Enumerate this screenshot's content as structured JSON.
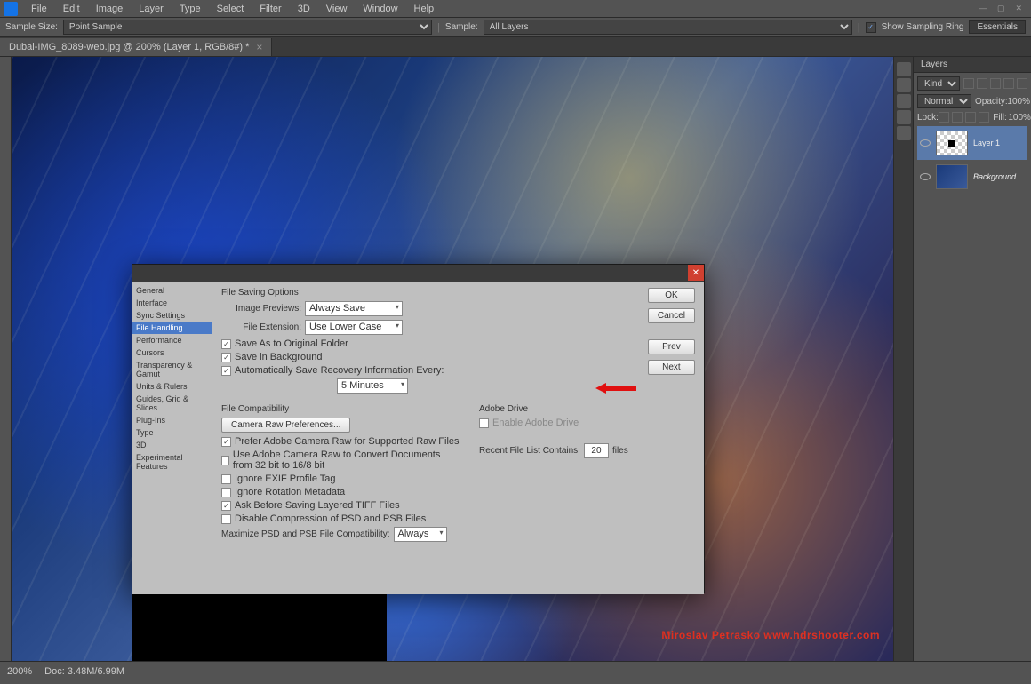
{
  "menubar": {
    "items": [
      "File",
      "Edit",
      "Image",
      "Layer",
      "Type",
      "Select",
      "Filter",
      "3D",
      "View",
      "Window",
      "Help"
    ]
  },
  "options": {
    "sample_size_label": "Sample Size:",
    "sample_size_value": "Point Sample",
    "sample_label": "Sample:",
    "sample_value": "All Layers",
    "sampling_ring": "Show Sampling Ring",
    "essentials": "Essentials"
  },
  "doc_tab": "Dubai-IMG_8089-web.jpg @ 200% (Layer 1, RGB/8#) *",
  "layers_panel": {
    "title": "Layers",
    "kind": "Kind",
    "blend": "Normal",
    "opacity_label": "Opacity:",
    "opacity_val": "100%",
    "lock_label": "Lock:",
    "fill_label": "Fill:",
    "fill_val": "100%",
    "layer1": "Layer 1",
    "background": "Background"
  },
  "dialog": {
    "nav": [
      "General",
      "Interface",
      "Sync Settings",
      "File Handling",
      "Performance",
      "Cursors",
      "Transparency & Gamut",
      "Units & Rulers",
      "Guides, Grid & Slices",
      "Plug-Ins",
      "Type",
      "3D",
      "Experimental Features"
    ],
    "selected_nav": "File Handling",
    "btn_ok": "OK",
    "btn_cancel": "Cancel",
    "btn_prev": "Prev",
    "btn_next": "Next",
    "saving_legend": "File Saving Options",
    "image_previews_label": "Image Previews:",
    "image_previews_value": "Always Save",
    "file_ext_label": "File Extension:",
    "file_ext_value": "Use Lower Case",
    "save_orig": "Save As to Original Folder",
    "save_bg": "Save in Background",
    "auto_recover": "Automatically Save Recovery Information Every:",
    "auto_recover_val": "5 Minutes",
    "compat_legend": "File Compatibility",
    "camera_raw_btn": "Camera Raw Preferences...",
    "prefer_acr": "Prefer Adobe Camera Raw for Supported Raw Files",
    "use_acr_convert": "Use Adobe Camera Raw to Convert Documents from 32 bit to 16/8 bit",
    "ignore_exif": "Ignore EXIF Profile Tag",
    "ignore_rot": "Ignore Rotation Metadata",
    "ask_tiff": "Ask Before Saving Layered TIFF Files",
    "disable_comp": "Disable Compression of PSD and PSB Files",
    "max_compat_label": "Maximize PSD and PSB File Compatibility:",
    "max_compat_val": "Always",
    "adobe_drive_legend": "Adobe Drive",
    "enable_drive": "Enable Adobe Drive",
    "recent_label": "Recent File List Contains:",
    "recent_val": "20",
    "recent_unit": "files"
  },
  "status": {
    "zoom": "200%",
    "doc": "Doc: 3.48M/6.99M"
  },
  "watermark": "Miroslav Petrasko  www.hdrshooter.com"
}
